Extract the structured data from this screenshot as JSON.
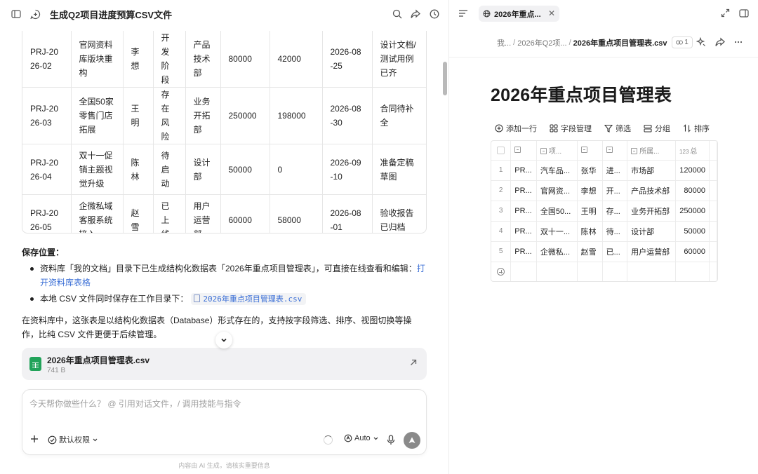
{
  "left": {
    "title": "生成Q2项目进度预算CSV文件",
    "table_rows": [
      [
        "PRJ-2026-02",
        "官网资料库版块重构",
        "李想",
        "开发阶段",
        "产品技术部",
        "80000",
        "42000",
        "2026-08-25",
        "设计文档/测试用例已齐"
      ],
      [
        "PRJ-2026-03",
        "全国50家零售门店拓展",
        "王明",
        "存在风险",
        "业务开拓部",
        "250000",
        "198000",
        "2026-08-30",
        "合同待补全"
      ],
      [
        "PRJ-2026-04",
        "双十一促销主题视觉升级",
        "陈林",
        "待启动",
        "设计部",
        "50000",
        "0",
        "2026-09-10",
        "准备定稿草图"
      ],
      [
        "PRJ-2026-05",
        "企微私域客服系统接入",
        "赵雪",
        "已上线",
        "用户运营部",
        "60000",
        "58000",
        "2026-08-01",
        "验收报告已归档"
      ]
    ],
    "save_title": "保存位置",
    "save_colon": "：",
    "bullet1_text": "资料库「我的文档」目录下已生成结构化数据表「2026年重点项目管理表」，可直接在线查看和编辑：",
    "bullet1_link": "打开资料库表格",
    "bullet2_text": "本地 CSV 文件同时保存在工作目录下：",
    "bullet2_file": "2026年重点项目管理表.csv",
    "paragraph": "在资料库中，这张表是以结构化数据表（Database）形式存在的，支持按字段筛选、排序、视图切换等操作，比纯 CSV 文件更便于后续管理。",
    "file_card": {
      "name": "2026年重点项目管理表.csv",
      "size": "741 B"
    },
    "composer": {
      "placeholder": "今天帮你做些什么？ @ 引用对话文件，/ 调用技能与指令",
      "permission": "默认权限",
      "model": "Auto"
    },
    "disclaimer": "内容由 AI 生成，请核实重要信息"
  },
  "right": {
    "tab_label": "2026年重点...",
    "breadcrumbs": [
      "我...",
      "2026年Q2项...",
      "2026年重点项目管理表.csv"
    ],
    "share_count": "1",
    "doc_title": "2026年重点项目管理表",
    "toolbar": {
      "add_row": "添加一行",
      "fields": "字段管理",
      "filter": "筛选",
      "group": "分组",
      "sort": "排序"
    },
    "grid_headers": [
      "",
      "项...",
      "",
      "",
      "所属...",
      "总"
    ],
    "grid_rows": [
      {
        "idx": "1",
        "id": "PR...",
        "name": "汽车品...",
        "owner": "张华",
        "status": "进...",
        "dept": "市场部",
        "budget": "120000"
      },
      {
        "idx": "2",
        "id": "PR...",
        "name": "官网资...",
        "owner": "李想",
        "status": "开...",
        "dept": "产品技术部",
        "budget": "80000"
      },
      {
        "idx": "3",
        "id": "PR...",
        "name": "全国50...",
        "owner": "王明",
        "status": "存...",
        "dept": "业务开拓部",
        "budget": "250000"
      },
      {
        "idx": "4",
        "id": "PR...",
        "name": "双十一...",
        "owner": "陈林",
        "status": "待...",
        "dept": "设计部",
        "budget": "50000"
      },
      {
        "idx": "5",
        "id": "PR...",
        "name": "企微私...",
        "owner": "赵雪",
        "status": "已...",
        "dept": "用户运营部",
        "budget": "60000"
      }
    ],
    "number_field_tag": "123"
  }
}
